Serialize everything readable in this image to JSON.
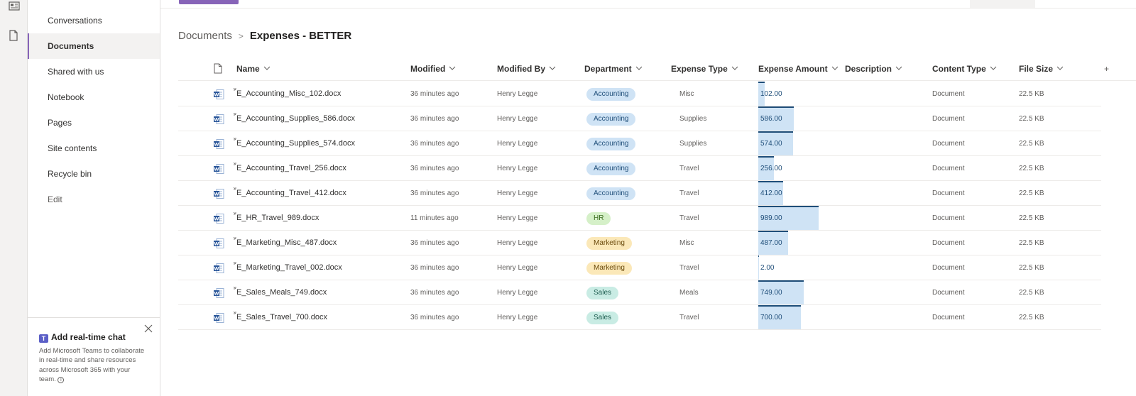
{
  "colors": {
    "accent": "#8764b8",
    "pill_accounting": "#cfe3f5",
    "pill_hr": "#d5f0c8",
    "pill_marketing": "#fbe8b8",
    "pill_sales": "#c9ece4",
    "amount_bar": "#cfe3f5"
  },
  "nav": {
    "items": [
      {
        "label": "Conversations",
        "active": false
      },
      {
        "label": "Documents",
        "active": true
      },
      {
        "label": "Shared with us",
        "active": false
      },
      {
        "label": "Notebook",
        "active": false
      },
      {
        "label": "Pages",
        "active": false
      },
      {
        "label": "Site contents",
        "active": false
      },
      {
        "label": "Recycle bin",
        "active": false
      },
      {
        "label": "Edit",
        "active": false
      }
    ]
  },
  "chat_card": {
    "title": "Add real-time chat",
    "description": "Add Microsoft Teams to collaborate in real-time and share resources across Microsoft 365 with your team."
  },
  "breadcrumb": {
    "root": "Documents",
    "separator": ">",
    "current": "Expenses - BETTER"
  },
  "columns": {
    "name": "Name",
    "modified": "Modified",
    "modified_by": "Modified By",
    "department": "Department",
    "expense_type": "Expense Type",
    "expense_amount": "Expense Amount",
    "description": "Description",
    "content_type": "Content Type",
    "file_size": "File Size",
    "add_column": "+"
  },
  "amount_scale_max": 1000,
  "rows": [
    {
      "name": "E_Accounting_Misc_102.docx",
      "modified": "36 minutes ago",
      "modified_by": "Henry Legge",
      "department": "Accounting",
      "expense_type": "Misc",
      "amount": "102.00",
      "amount_value": 102,
      "content_type": "Document",
      "file_size": "22.5 KB"
    },
    {
      "name": "E_Accounting_Supplies_586.docx",
      "modified": "36 minutes ago",
      "modified_by": "Henry Legge",
      "department": "Accounting",
      "expense_type": "Supplies",
      "amount": "586.00",
      "amount_value": 586,
      "content_type": "Document",
      "file_size": "22.5 KB"
    },
    {
      "name": "E_Accounting_Supplies_574.docx",
      "modified": "36 minutes ago",
      "modified_by": "Henry Legge",
      "department": "Accounting",
      "expense_type": "Supplies",
      "amount": "574.00",
      "amount_value": 574,
      "content_type": "Document",
      "file_size": "22.5 KB"
    },
    {
      "name": "E_Accounting_Travel_256.docx",
      "modified": "36 minutes ago",
      "modified_by": "Henry Legge",
      "department": "Accounting",
      "expense_type": "Travel",
      "amount": "256.00",
      "amount_value": 256,
      "content_type": "Document",
      "file_size": "22.5 KB"
    },
    {
      "name": "E_Accounting_Travel_412.docx",
      "modified": "36 minutes ago",
      "modified_by": "Henry Legge",
      "department": "Accounting",
      "expense_type": "Travel",
      "amount": "412.00",
      "amount_value": 412,
      "content_type": "Document",
      "file_size": "22.5 KB"
    },
    {
      "name": "E_HR_Travel_989.docx",
      "modified": "11 minutes ago",
      "modified_by": "Henry Legge",
      "department": "HR",
      "expense_type": "Travel",
      "amount": "989.00",
      "amount_value": 989,
      "content_type": "Document",
      "file_size": "22.5 KB"
    },
    {
      "name": "E_Marketing_Misc_487.docx",
      "modified": "36 minutes ago",
      "modified_by": "Henry Legge",
      "department": "Marketing",
      "expense_type": "Misc",
      "amount": "487.00",
      "amount_value": 487,
      "content_type": "Document",
      "file_size": "22.5 KB"
    },
    {
      "name": "E_Marketing_Travel_002.docx",
      "modified": "36 minutes ago",
      "modified_by": "Henry Legge",
      "department": "Marketing",
      "expense_type": "Travel",
      "amount": "2.00",
      "amount_value": 2,
      "content_type": "Document",
      "file_size": "22.5 KB"
    },
    {
      "name": "E_Sales_Meals_749.docx",
      "modified": "36 minutes ago",
      "modified_by": "Henry Legge",
      "department": "Sales",
      "expense_type": "Meals",
      "amount": "749.00",
      "amount_value": 749,
      "content_type": "Document",
      "file_size": "22.5 KB"
    },
    {
      "name": "E_Sales_Travel_700.docx",
      "modified": "36 minutes ago",
      "modified_by": "Henry Legge",
      "department": "Sales",
      "expense_type": "Travel",
      "amount": "700.00",
      "amount_value": 700,
      "content_type": "Document",
      "file_size": "22.5 KB"
    }
  ]
}
